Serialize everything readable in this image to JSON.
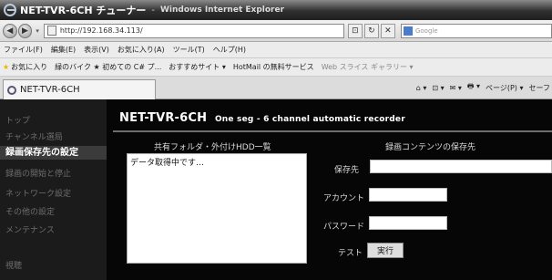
{
  "window": {
    "title": "NET-TVR-6CH チューナー",
    "separator": "-",
    "app_name": "Windows Internet Explorer"
  },
  "address_bar": {
    "url": "http://192.168.34.113/",
    "search_placeholder": "Google"
  },
  "menu": [
    "ファイル(F)",
    "編集(E)",
    "表示(V)",
    "お気に入り(A)",
    "ツール(T)",
    "ヘルプ(H)"
  ],
  "favorites_bar": {
    "favorites_label": "お気に入り",
    "items": [
      "緑のバイク ★ 初めての C# プ...",
      "おすすめサイト ▾",
      "HotMail の無料サービス",
      "Web スライス ギャラリー ▾"
    ]
  },
  "tab": {
    "label": "NET-TVR-6CH",
    "tools": [
      "⌂ ▾",
      "⊡ ▾",
      "✉ ▾",
      "🖶 ▾",
      "ページ(P) ▾",
      "セーフ"
    ]
  },
  "sidebar": {
    "items": [
      {
        "label": "トップ",
        "active": false
      },
      {
        "label": "チャンネル選局",
        "active": false
      },
      {
        "label": "録画保存先の設定",
        "active": true
      },
      {
        "label": "録画の開始と停止",
        "active": false
      },
      {
        "label": "ネットワーク設定",
        "active": false
      },
      {
        "label": "その他の設定",
        "active": false
      },
      {
        "label": "メンテナンス",
        "active": false
      },
      {
        "label": "視聴",
        "active": false
      }
    ]
  },
  "main": {
    "title": "NET-TVR-6CH",
    "subtitle": "One seg - 6 channel automatic recorder",
    "list_heading": "共有フォルダ・外付けHDD一覧",
    "list_item": "データ取得中です…",
    "save_heading": "録画コンテンツの保存先",
    "save_label": "保存先",
    "account_label": "アカウント",
    "password_label": "パスワード",
    "test_label": "テスト",
    "execute_button": "実行"
  }
}
